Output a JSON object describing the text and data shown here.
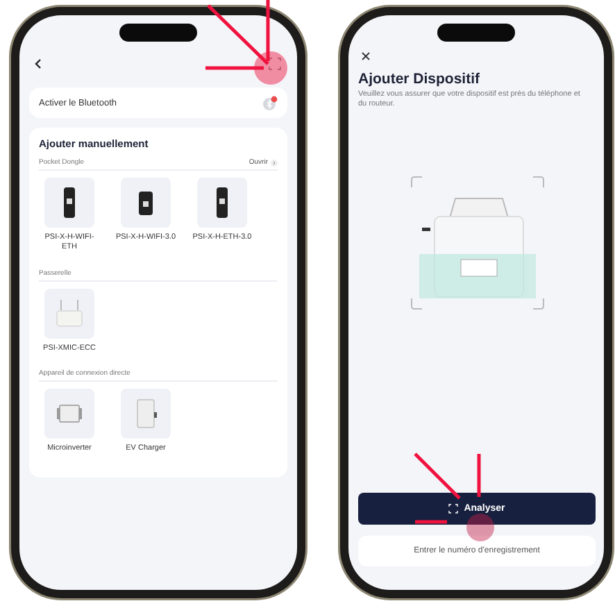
{
  "left_screen": {
    "bluetooth": {
      "label": "Activer le Bluetooth"
    },
    "manual": {
      "title": "Ajouter manuellement",
      "sections": [
        {
          "title": "Pocket Dongle",
          "action": "Ouvrir",
          "devices": [
            {
              "name": "PSI-X-H-WIFI-ETH",
              "kind": "dongle"
            },
            {
              "name": "PSI-X-H-WIFI-3.0",
              "kind": "dongle-wide"
            },
            {
              "name": "PSI-X-H-ETH-3.0",
              "kind": "dongle"
            }
          ]
        },
        {
          "title": "Passerelle",
          "devices": [
            {
              "name": "PSI-XMIC-ECC",
              "kind": "gateway"
            }
          ]
        },
        {
          "title": "Appareil de connexion directe",
          "devices": [
            {
              "name": "Microinverter",
              "kind": "microinverter"
            },
            {
              "name": "EV Charger",
              "kind": "charger"
            }
          ]
        }
      ]
    }
  },
  "right_screen": {
    "title": "Ajouter Dispositif",
    "subtitle": "Veuillez vous assurer que votre dispositif est près du téléphone et du routeur.",
    "primary_button": "Analyser",
    "secondary_button": "Entrer le numéro d'enregistrement"
  }
}
